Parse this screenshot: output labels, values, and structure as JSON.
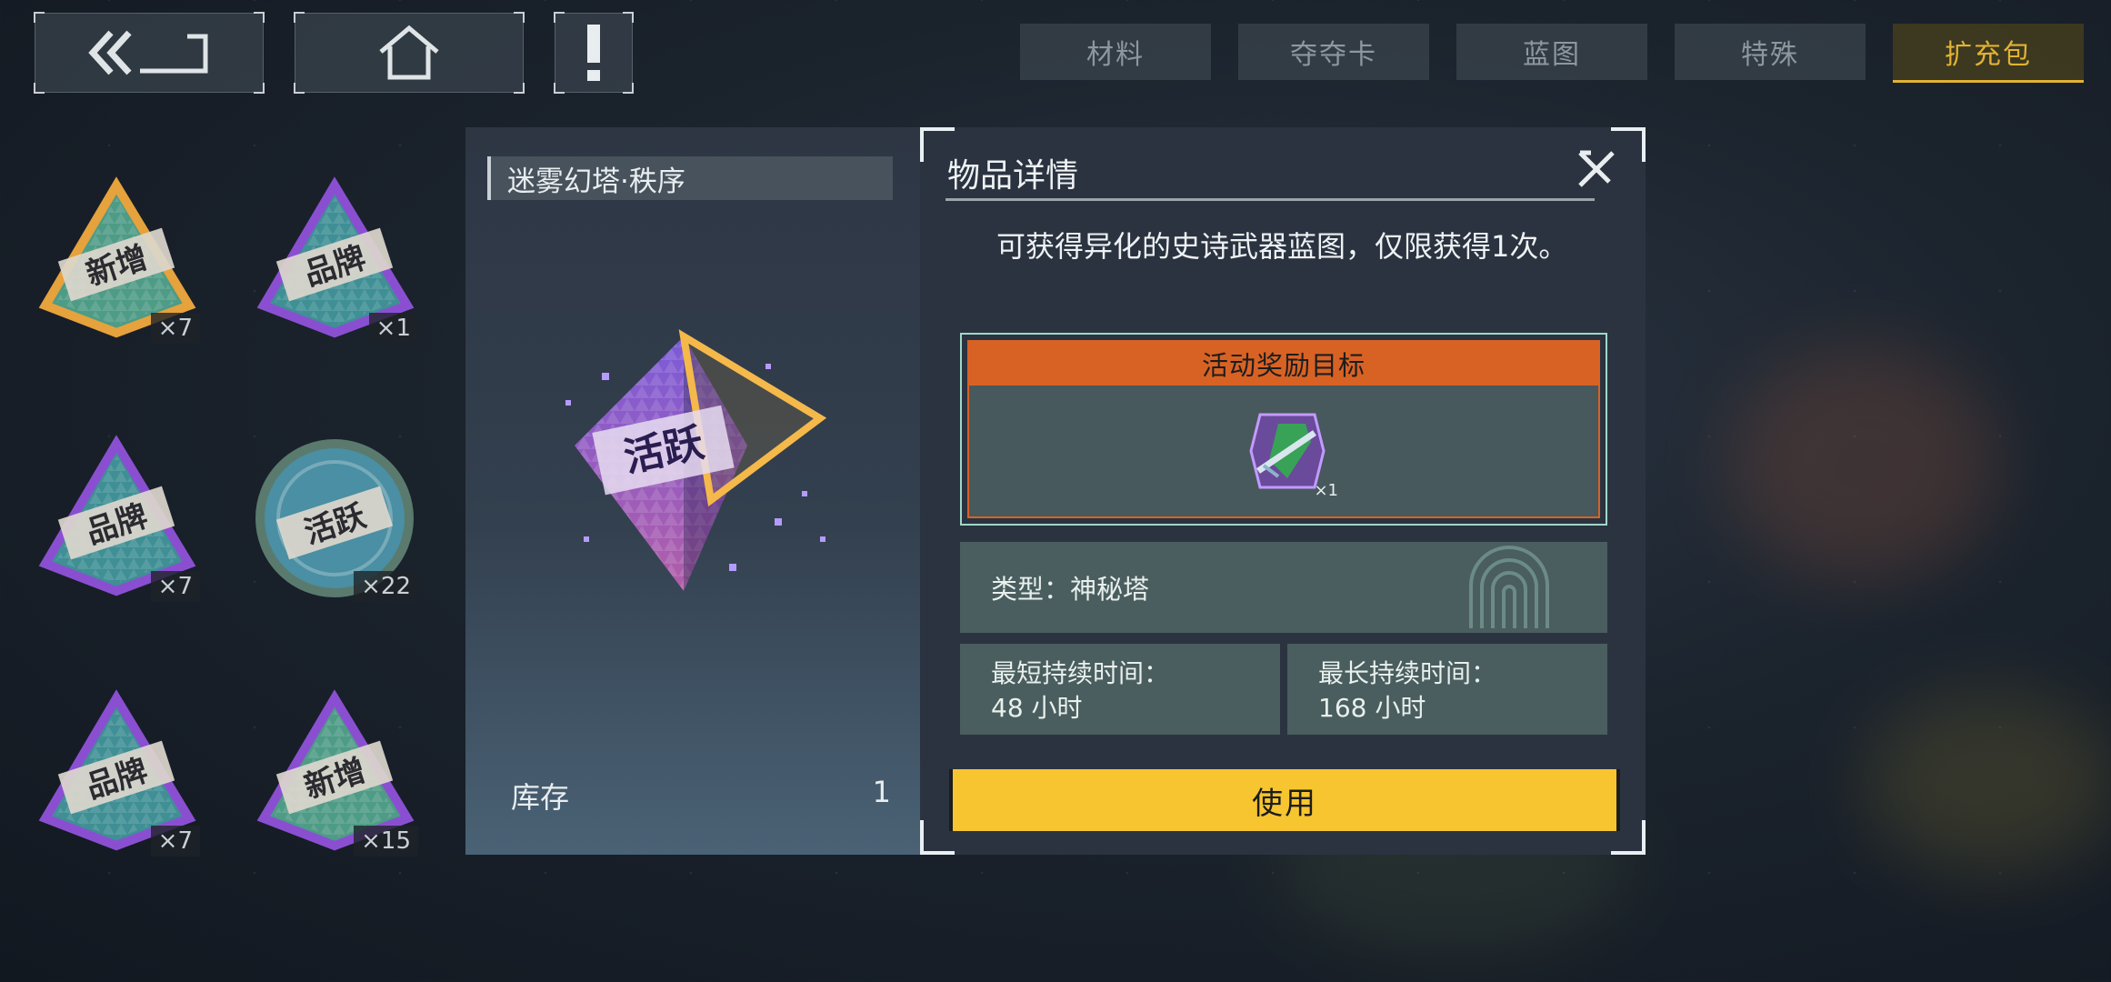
{
  "top_bar": {
    "back_icon": "double-chevron-back-icon",
    "home_icon": "home-icon",
    "alert_icon": "exclamation-icon"
  },
  "tabs": [
    {
      "label": "材料",
      "active": false
    },
    {
      "label": "夺夺卡",
      "active": false
    },
    {
      "label": "蓝图",
      "active": false
    },
    {
      "label": "特殊",
      "active": false
    },
    {
      "label": "扩充包",
      "active": true
    }
  ],
  "inventory": {
    "items": [
      {
        "label": "新增",
        "count": "×7",
        "frame": "#e6a23c",
        "inner": "#4e9b86"
      },
      {
        "label": "品牌",
        "count": "×1",
        "frame": "#8a4fd1",
        "inner": "#3f8f95"
      },
      {
        "label": "品牌",
        "count": "×7",
        "frame": "#8a4fd1",
        "inner": "#3f8f95"
      },
      {
        "label": "活跃",
        "count": "×22",
        "frame": "#5a7a6e",
        "inner": "#4a8fa3"
      },
      {
        "label": "品牌",
        "count": "×7",
        "frame": "#8a4fd1",
        "inner": "#3f8f95"
      },
      {
        "label": "新增",
        "count": "×15",
        "frame": "#8a4fd1",
        "inner": "#4e9b86"
      }
    ]
  },
  "detail_left": {
    "title": "迷雾幻塔·秩序",
    "item_label": "活跃",
    "stock_label": "库存",
    "stock_value": "1"
  },
  "detail_right": {
    "title": "物品详情",
    "description": "可获得异化的史诗武器蓝图，仅限获得1次。",
    "reward_header": "活动奖励目标",
    "reward_count": "×1",
    "type_text": "类型：神秘塔",
    "min_duration_label": "最短持续时间：",
    "min_duration_value": "48 小时",
    "max_duration_label": "最长持续时间：",
    "max_duration_value": "168 小时",
    "use_button": "使用"
  },
  "colors": {
    "accent_gold": "#e1b233",
    "use_button": "#f7c52f",
    "reward_header": "#d86224",
    "info_box": "#4a5d5f"
  }
}
